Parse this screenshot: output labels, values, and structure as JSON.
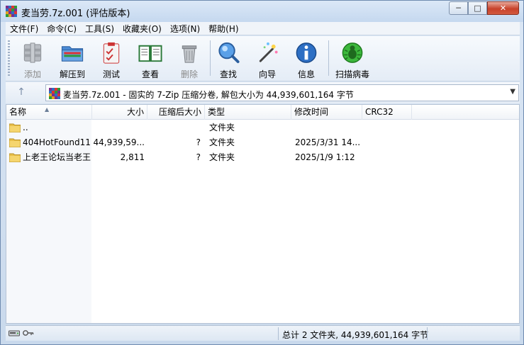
{
  "window": {
    "title": "麦当劳.7z.001 (评估版本)",
    "controls": {
      "minimize": "─",
      "maximize": "□",
      "close": "✕"
    }
  },
  "menu": [
    "文件(F)",
    "命令(C)",
    "工具(S)",
    "收藏夹(O)",
    "选项(N)",
    "帮助(H)"
  ],
  "toolbar": {
    "add": "添加",
    "extract": "解压到",
    "test": "测试",
    "view": "查看",
    "delete": "删除",
    "find": "查找",
    "wizard": "向导",
    "info": "信息",
    "scan": "扫描病毒"
  },
  "address": {
    "text": "麦当劳.7z.001 - 固实的 7-Zip 压缩分卷, 解包大小为 44,939,601,164 字节"
  },
  "columns": {
    "name": "名称",
    "size": "大小",
    "packed": "压缩后大小",
    "type": "类型",
    "modified": "修改时间",
    "crc": "CRC32"
  },
  "files": [
    {
      "name": "..",
      "size": "",
      "packed": "",
      "type": "文件夹",
      "modified": ""
    },
    {
      "name": "404HotFound11",
      "size": "44,939,59...",
      "packed": "?",
      "type": "文件夹",
      "modified": "2025/3/31 14..."
    },
    {
      "name": "上老王论坛当老王",
      "size": "2,811",
      "packed": "?",
      "type": "文件夹",
      "modified": "2025/1/9 1:12"
    }
  ],
  "status": {
    "summary": "总计 2 文件夹, 44,939,601,164 字节"
  },
  "colors": {
    "window_frame": "#c9d9ec",
    "close_red": "#c7422b",
    "folder_yellow": "#e9c04a"
  }
}
